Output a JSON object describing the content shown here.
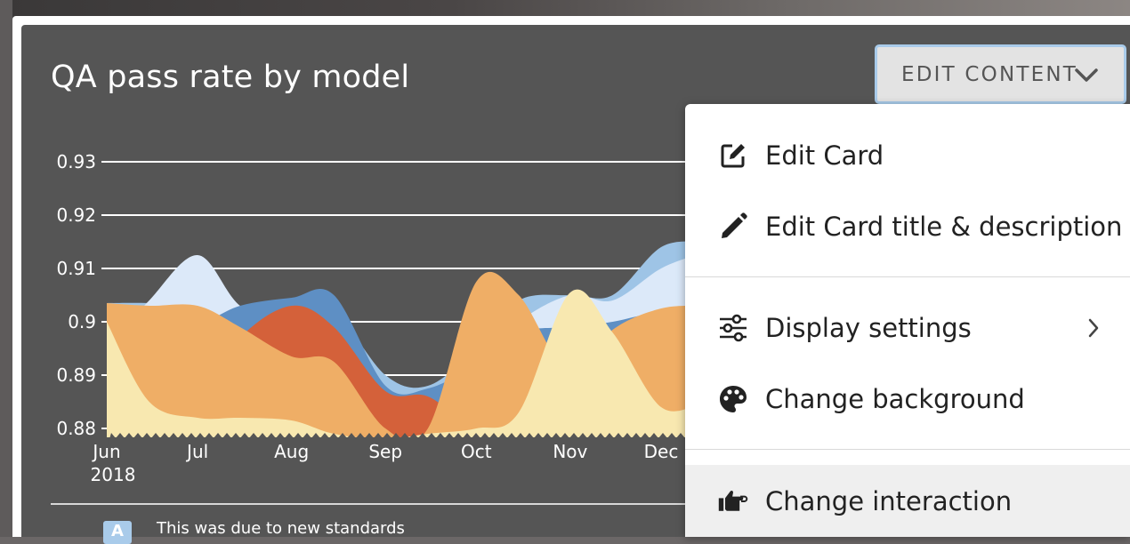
{
  "card": {
    "title": "QA pass rate by model"
  },
  "edit_button": {
    "label": "EDIT CONTENT",
    "icon": "chevron-down-icon"
  },
  "chart_data": {
    "type": "area",
    "title": "QA pass rate by model",
    "x_tick_labels": [
      "Jun",
      "Jul",
      "Aug",
      "Sep",
      "Oct",
      "Nov",
      "Dec"
    ],
    "x_year_label": "2018",
    "y_tick_labels": [
      "0.93",
      "0.92",
      "0.91",
      "0.9",
      "0.89",
      "0.88"
    ],
    "ylim": [
      0.88,
      0.93
    ],
    "grid": true,
    "series": [
      {
        "color": "#9ec4e6",
        "x": [
          "2018-06-01",
          "2018-06-15",
          "2018-07-01",
          "2018-07-15",
          "2018-08-01",
          "2018-08-15",
          "2018-09-01",
          "2018-09-15",
          "2018-10-01",
          "2018-10-15",
          "2018-11-01",
          "2018-11-15",
          "2018-12-01",
          "2018-12-15"
        ],
        "values": [
          0.9035,
          0.9035,
          0.903,
          0.9025,
          0.902,
          0.902,
          0.89,
          0.888,
          0.895,
          0.904,
          0.905,
          0.905,
          0.914,
          0.915
        ]
      },
      {
        "color": "#dce9f9",
        "x": [
          "2018-06-01",
          "2018-06-15",
          "2018-07-01",
          "2018-07-15",
          "2018-08-01",
          "2018-08-15",
          "2018-09-01",
          "2018-09-15",
          "2018-10-01",
          "2018-10-15",
          "2018-11-01",
          "2018-11-15",
          "2018-12-01",
          "2018-12-15"
        ],
        "values": [
          0.895,
          0.904,
          0.9125,
          0.903,
          0.899,
          0.898,
          0.887,
          0.886,
          0.892,
          0.9,
          0.905,
          0.904,
          0.91,
          0.913
        ]
      },
      {
        "color": "#5e8fc4",
        "x": [
          "2018-06-01",
          "2018-06-15",
          "2018-07-01",
          "2018-07-15",
          "2018-08-01",
          "2018-08-15",
          "2018-09-01",
          "2018-09-15",
          "2018-10-01",
          "2018-10-15",
          "2018-11-01",
          "2018-11-15",
          "2018-12-01",
          "2018-12-15"
        ],
        "values": [
          0.899,
          0.899,
          0.8995,
          0.903,
          0.9045,
          0.905,
          0.888,
          0.8875,
          0.892,
          0.898,
          0.899,
          0.9,
          0.902,
          0.9025
        ]
      },
      {
        "color": "#d4613a",
        "x": [
          "2018-06-01",
          "2018-06-15",
          "2018-07-01",
          "2018-07-15",
          "2018-08-01",
          "2018-08-15",
          "2018-09-01",
          "2018-09-15",
          "2018-10-01",
          "2018-10-15",
          "2018-11-01",
          "2018-11-15",
          "2018-12-01",
          "2018-12-15"
        ],
        "values": [
          0.88,
          0.88,
          0.885,
          0.897,
          0.903,
          0.899,
          0.887,
          0.886,
          0.88,
          0.88,
          0.88,
          0.88,
          0.88,
          0.88
        ]
      },
      {
        "color": "#efae66",
        "x": [
          "2018-06-01",
          "2018-06-15",
          "2018-07-01",
          "2018-07-15",
          "2018-08-01",
          "2018-08-15",
          "2018-09-01",
          "2018-09-15",
          "2018-10-01",
          "2018-10-15",
          "2018-11-01",
          "2018-11-15",
          "2018-12-01",
          "2018-12-15"
        ],
        "values": [
          0.9035,
          0.903,
          0.903,
          0.899,
          0.8935,
          0.8925,
          0.88,
          0.88,
          0.9075,
          0.905,
          0.89,
          0.8985,
          0.9025,
          0.903
        ]
      },
      {
        "color": "#f8e8b0",
        "x": [
          "2018-06-01",
          "2018-06-15",
          "2018-07-01",
          "2018-07-15",
          "2018-08-01",
          "2018-08-15",
          "2018-09-01",
          "2018-09-15",
          "2018-10-01",
          "2018-10-15",
          "2018-11-01",
          "2018-11-15",
          "2018-12-01",
          "2018-12-15"
        ],
        "values": [
          0.9,
          0.885,
          0.882,
          0.882,
          0.8815,
          0.879,
          0.878,
          0.879,
          0.88,
          0.883,
          0.9055,
          0.898,
          0.884,
          0.885
        ]
      }
    ]
  },
  "annotation": {
    "badge": "A",
    "text": "This was due to new standards"
  },
  "menu": {
    "items": [
      {
        "label": "Edit Card",
        "icon": "edit-card-icon"
      },
      {
        "label": "Edit Card title & description",
        "icon": "pencil-icon"
      },
      {
        "label": "Display settings",
        "icon": "sliders-icon",
        "has_submenu": true
      },
      {
        "label": "Change background",
        "icon": "palette-icon"
      },
      {
        "label": "Change interaction",
        "icon": "pointing-hand-icon"
      }
    ]
  }
}
